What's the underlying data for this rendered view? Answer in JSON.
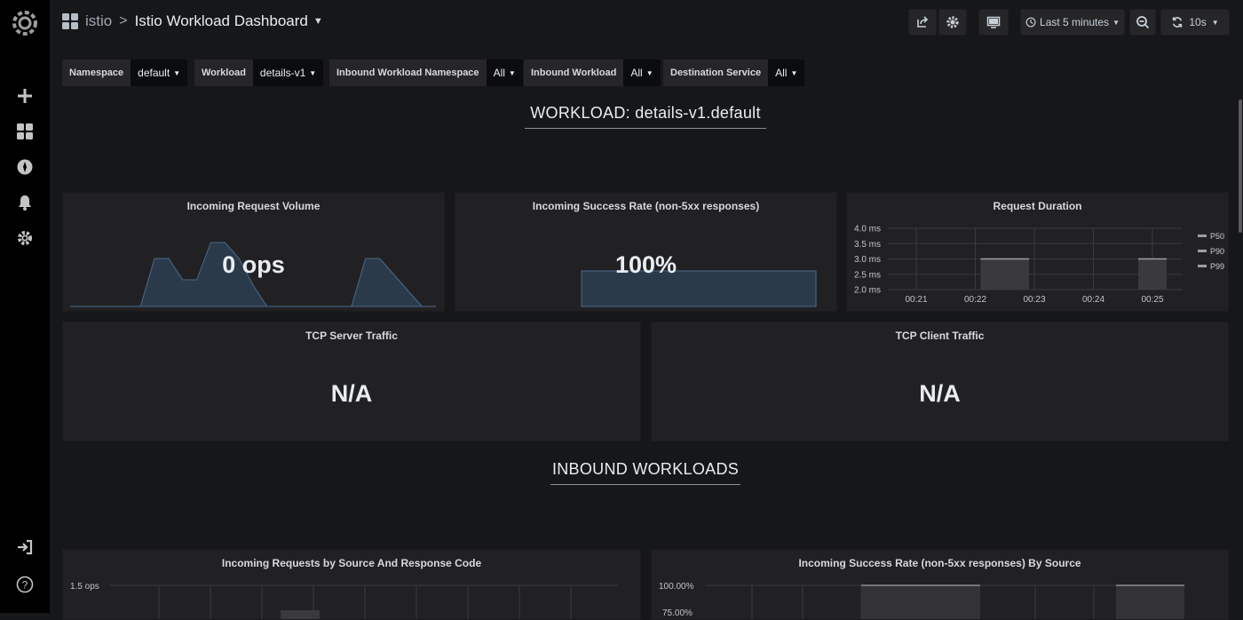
{
  "breadcrumb": {
    "folder": "istio",
    "separator": ">",
    "title": "Istio Workload Dashboard"
  },
  "toolbar": {
    "time_range": "Last 5 minutes",
    "refresh_interval": "10s"
  },
  "variables": [
    {
      "label": "Namespace",
      "value": "default"
    },
    {
      "label": "Workload",
      "value": "details-v1"
    },
    {
      "label": "Inbound Workload Namespace",
      "value": "All"
    },
    {
      "label": "Inbound Workload",
      "value": "All"
    },
    {
      "label": "Destination Service",
      "value": "All"
    }
  ],
  "sections": {
    "workload": "WORKLOAD: details-v1.default",
    "inbound": "INBOUND WORKLOADS"
  },
  "panels": {
    "incoming_request_volume": {
      "title": "Incoming Request Volume",
      "value": "0 ops"
    },
    "incoming_success_rate": {
      "title": "Incoming Success Rate (non-5xx responses)",
      "value": "100%"
    },
    "request_duration": {
      "title": "Request Duration",
      "y_ticks": [
        "4.0 ms",
        "3.5 ms",
        "3.0 ms",
        "2.5 ms",
        "2.0 ms"
      ],
      "x_ticks": [
        "00:21",
        "00:22",
        "00:23",
        "00:24",
        "00:25"
      ],
      "legend": [
        "P50",
        "P90",
        "P99"
      ]
    },
    "tcp_server_traffic": {
      "title": "TCP Server Traffic",
      "value": "N/A"
    },
    "tcp_client_traffic": {
      "title": "TCP Client Traffic",
      "value": "N/A"
    },
    "incoming_requests_by_source": {
      "title": "Incoming Requests by Source And Response Code",
      "y_tick": "1.5 ops"
    },
    "incoming_success_rate_by_source": {
      "title": "Incoming Success Rate (non-5xx responses) By Source",
      "y_tick_top": "100.00%",
      "y_tick_second": "75.00%"
    }
  },
  "chart_data": [
    {
      "type": "area",
      "title": "Incoming Request Volume",
      "series": [
        {
          "values": [
            0,
            0,
            0,
            0,
            0,
            0,
            0.9,
            0.9,
            0.5,
            0.5,
            1.2,
            1.2,
            0.9,
            0.4,
            0,
            0,
            0,
            0,
            0,
            0,
            0,
            0.9,
            0.9,
            0.6,
            0.3,
            0,
            0
          ]
        }
      ]
    },
    {
      "type": "area",
      "title": "Incoming Success Rate (non-5xx responses)",
      "series": [
        {
          "values": [
            100,
            100,
            100,
            100,
            100
          ]
        }
      ]
    },
    {
      "type": "area",
      "title": "Request Duration",
      "x": [
        "00:21",
        "00:22",
        "00:23",
        "00:24",
        "00:25"
      ],
      "ylim": [
        2.0,
        4.0
      ],
      "series": [
        {
          "name": "P50",
          "segments": [
            {
              "from": "00:22",
              "to": "00:23",
              "value": 3.0
            },
            {
              "from": "00:25",
              "to": "00:25",
              "value": 3.0
            }
          ]
        },
        {
          "name": "P90",
          "segments": []
        },
        {
          "name": "P99",
          "segments": []
        }
      ]
    }
  ],
  "colors": {
    "background": "#161719",
    "panel": "#212124",
    "sparkline_fill": "#2b3a4a",
    "sparkline_line": "#4a6a8a",
    "bar_fill": "#3a3a3c"
  }
}
